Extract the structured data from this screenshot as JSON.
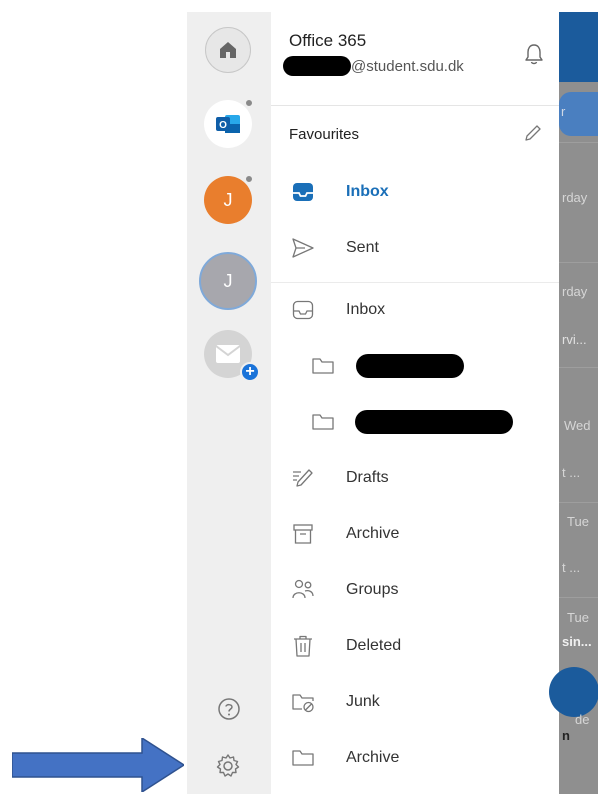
{
  "drawer": {
    "account_title": "Office 365",
    "account_email": "@student.sdu.dk",
    "favourites_label": "Favourites",
    "favourites": [
      {
        "label": "Inbox",
        "icon": "inbox-icon",
        "active": true
      },
      {
        "label": "Sent",
        "icon": "send-icon",
        "active": false
      }
    ],
    "folders": [
      {
        "label": "Inbox",
        "icon": "inbox-icon"
      },
      {
        "label": "",
        "icon": "folder-icon",
        "redacted": true
      },
      {
        "label": "",
        "icon": "folder-icon",
        "redacted": true
      },
      {
        "label": "Drafts",
        "icon": "drafts-icon"
      },
      {
        "label": "Archive",
        "icon": "archive-icon"
      },
      {
        "label": "Groups",
        "icon": "groups-icon"
      },
      {
        "label": "Deleted",
        "icon": "trash-icon"
      },
      {
        "label": "Junk",
        "icon": "junk-icon"
      },
      {
        "label": "Archive",
        "icon": "folder-icon"
      }
    ]
  },
  "rail": {
    "avatar_initial_1": "J",
    "avatar_initial_2": "J"
  },
  "background_list": {
    "fragments": [
      "r",
      "rday",
      "rday",
      "rvi...",
      "Wed",
      "t ...",
      "Tue",
      "t ...",
      "Tue",
      "sin...",
      "de",
      "n"
    ]
  },
  "colors": {
    "accent": "#1a6fb8",
    "arrow": "#4472c4",
    "rail_bg": "#efefef",
    "avatar_orange": "#e97e2d"
  }
}
